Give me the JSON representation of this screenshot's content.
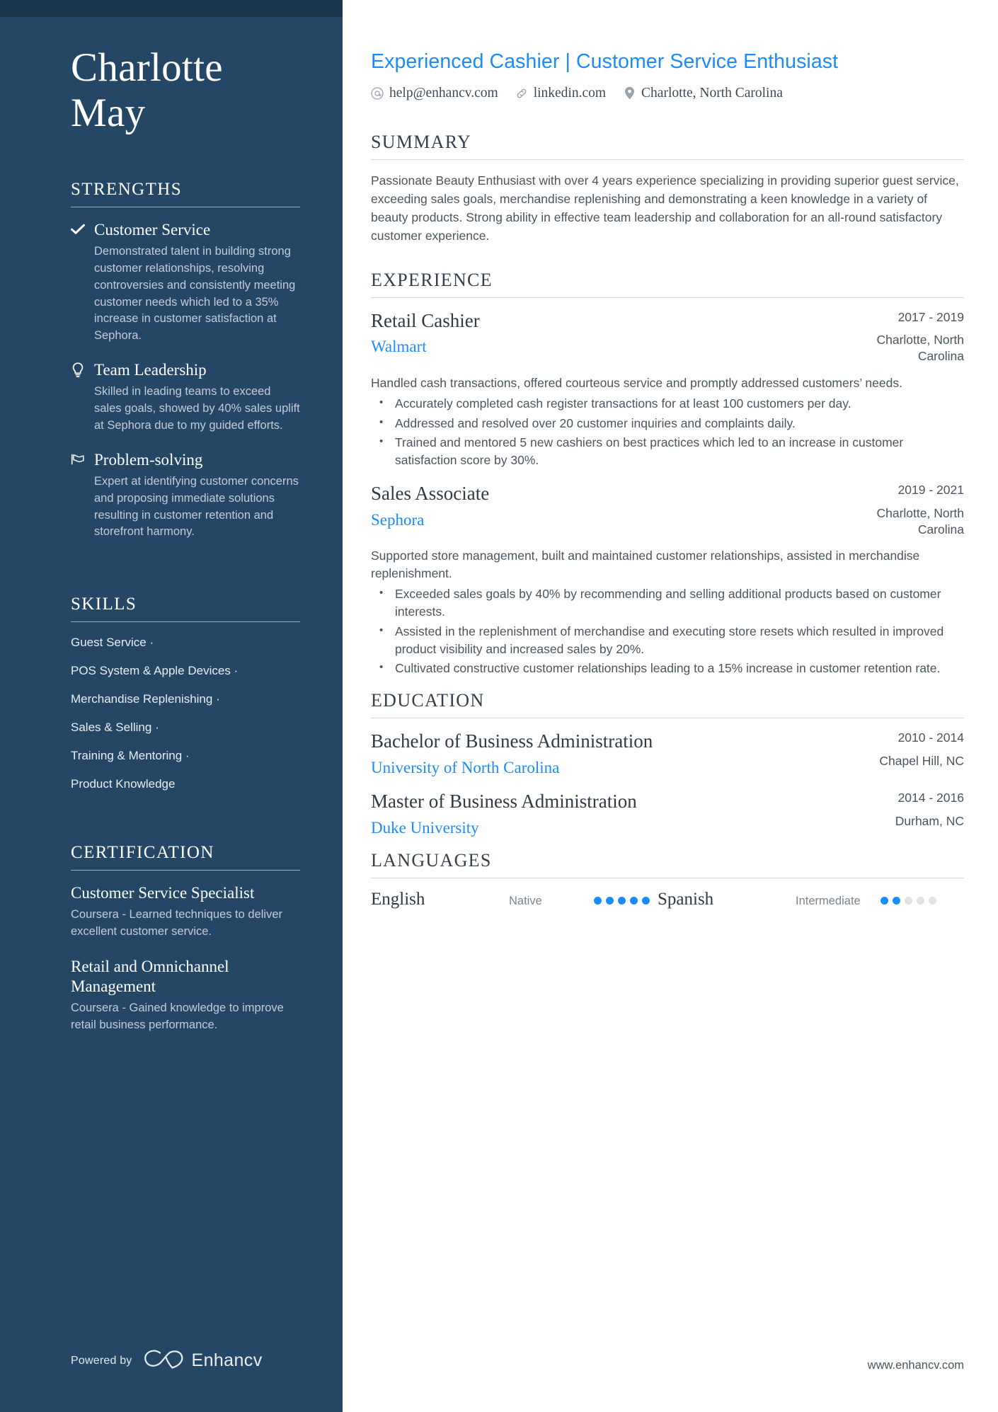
{
  "sidebar": {
    "name_line1": "Charlotte",
    "name_line2": "May",
    "strengths_heading": "STRENGTHS",
    "strengths": [
      {
        "icon": "check-icon",
        "title": "Customer Service",
        "description": "Demonstrated talent in building strong customer relationships, resolving controversies and consistently meeting customer needs which led to a 35% increase in customer satisfaction at Sephora."
      },
      {
        "icon": "lightbulb-icon",
        "title": "Team Leadership",
        "description": "Skilled in leading teams to exceed sales goals, showed by 40% sales uplift at Sephora due to my guided efforts."
      },
      {
        "icon": "flag-icon",
        "title": "Problem-solving",
        "description": "Expert at identifying customer concerns and proposing immediate solutions resulting in customer retention and storefront harmony."
      }
    ],
    "skills_heading": "SKILLS",
    "skills": [
      "Guest Service ·",
      "POS System & Apple Devices ·",
      "Merchandise Replenishing ·",
      "Sales & Selling ·",
      "Training & Mentoring ·",
      "Product Knowledge"
    ],
    "certification_heading": "CERTIFICATION",
    "certifications": [
      {
        "title": "Customer Service Specialist",
        "description": "Coursera - Learned techniques to deliver excellent customer service."
      },
      {
        "title": "Retail and Omnichannel Management",
        "description": "Coursera - Gained knowledge to improve retail business performance."
      }
    ],
    "footer": {
      "powered_by": "Powered by",
      "brand": "Enhancv"
    }
  },
  "main": {
    "headline": "Experienced Cashier | Customer Service Enthusiast",
    "contacts": [
      {
        "icon": "email-icon",
        "text": "help@enhancv.com"
      },
      {
        "icon": "link-icon",
        "text": "linkedin.com"
      },
      {
        "icon": "location-pin-icon",
        "text": "Charlotte, North Carolina"
      }
    ],
    "summary": {
      "heading": "SUMMARY",
      "text": "Passionate Beauty Enthusiast with over 4 years experience specializing in providing superior guest service, exceeding sales goals, merchandise replenishing and demonstrating a keen knowledge in a variety of beauty products. Strong ability in effective team leadership and collaboration for an all-round satisfactory customer experience."
    },
    "experience": {
      "heading": "EXPERIENCE",
      "entries": [
        {
          "title": "Retail Cashier",
          "company": "Walmart",
          "dates": "2017 - 2019",
          "location": "Charlotte, North Carolina",
          "description": "Handled cash transactions, offered courteous service and promptly addressed customers’ needs.",
          "bullets": [
            "Accurately completed cash register transactions for at least 100 customers per day.",
            "Addressed and resolved over 20 customer inquiries and complaints daily.",
            "Trained and mentored 5 new cashiers on best practices which led to an increase in customer satisfaction score by 30%."
          ]
        },
        {
          "title": "Sales Associate",
          "company": "Sephora",
          "dates": "2019 - 2021",
          "location": "Charlotte, North Carolina",
          "description": "Supported store management, built and maintained customer relationships, assisted in merchandise replenishment.",
          "bullets": [
            "Exceeded sales goals by 40% by recommending and selling additional products based on customer interests.",
            "Assisted in the replenishment of merchandise and executing store resets which resulted in improved product visibility and increased sales by 20%.",
            "Cultivated constructive customer relationships leading to a 15% increase in customer retention rate."
          ]
        }
      ]
    },
    "education": {
      "heading": "EDUCATION",
      "entries": [
        {
          "degree": "Bachelor of Business Administration",
          "school": "University of North Carolina",
          "dates": "2010 - 2014",
          "location": "Chapel Hill, NC"
        },
        {
          "degree": "Master of Business Administration",
          "school": "Duke University",
          "dates": "2014 - 2016",
          "location": "Durham, NC"
        }
      ]
    },
    "languages": {
      "heading": "LANGUAGES",
      "items": [
        {
          "name": "English",
          "level": "Native",
          "filled": 5,
          "total": 5
        },
        {
          "name": "Spanish",
          "level": "Intermediate",
          "filled": 2,
          "total": 5
        }
      ]
    },
    "site_url": "www.enhancv.com"
  },
  "colors": {
    "sidebar_bg": "#244766",
    "sidebar_top": "#1c364d",
    "accent_blue": "#1a8cff",
    "heading_dark": "#333f4a",
    "body_text": "#4a555f"
  }
}
